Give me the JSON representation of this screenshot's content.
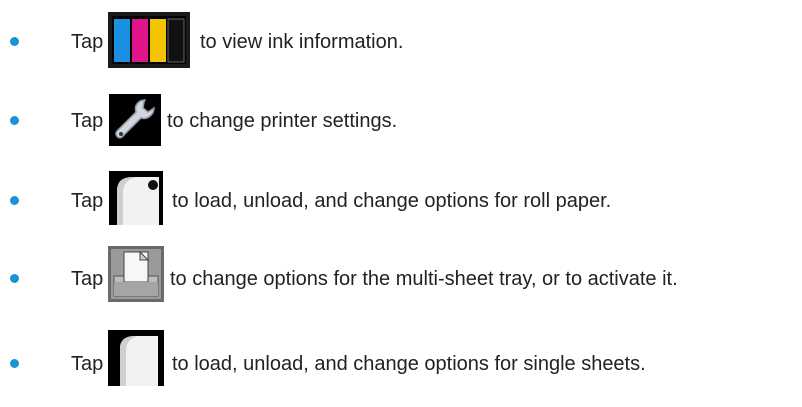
{
  "bullet_color": "#1e90d6",
  "items": [
    {
      "tap": "Tap",
      "icon": "ink-cartridges-icon",
      "text": "to view ink information."
    },
    {
      "tap": "Tap",
      "icon": "wrench-icon",
      "text": "to change printer settings."
    },
    {
      "tap": "Tap",
      "icon": "roll-paper-icon",
      "text": "to load, unload, and change options for roll paper."
    },
    {
      "tap": "Tap",
      "icon": "multi-sheet-tray-icon",
      "text": "to change options for the multi-sheet tray, or to activate it."
    },
    {
      "tap": "Tap",
      "icon": "single-sheet-icon",
      "text": "to load, unload, and change options for single sheets."
    }
  ]
}
